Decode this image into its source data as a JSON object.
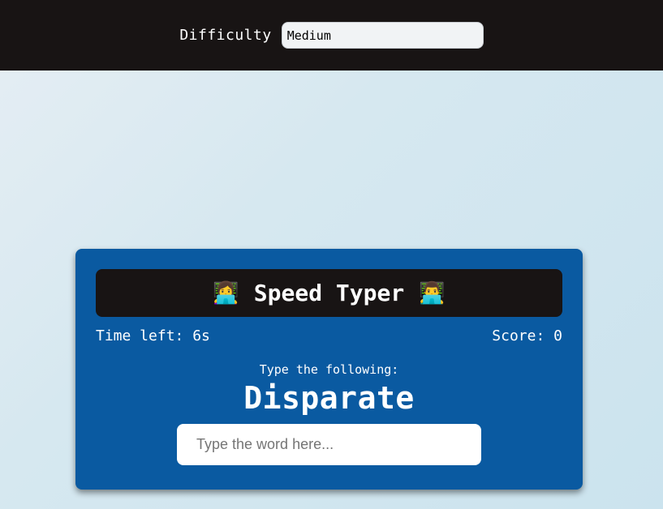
{
  "settings": {
    "difficulty_label": "Difficulty",
    "difficulty_value": "Medium"
  },
  "game": {
    "title": "Speed Typer",
    "emoji_left": "👩‍💻",
    "emoji_right": "👨‍💻",
    "time_label": "Time left: 6s",
    "score_label": "Score: 0",
    "prompt": "Type the following:",
    "word": "Disparate",
    "input_placeholder": "Type the word here..."
  },
  "colors": {
    "topbar": "#181414",
    "card": "#0a5aa1",
    "text": "#ffffff"
  }
}
